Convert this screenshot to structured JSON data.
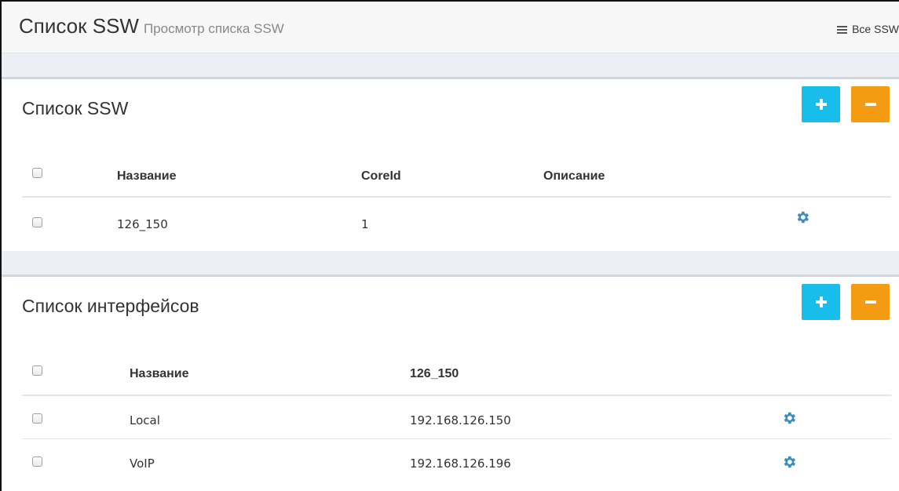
{
  "header": {
    "title": "Список SSW",
    "subtitle": "Просмотр списка SSW",
    "link_label": "Все SSW"
  },
  "ssw_section": {
    "title": "Список SSW",
    "columns": [
      "Название",
      "CoreId",
      "Описание"
    ],
    "rows": [
      {
        "name": "126_150",
        "core_id": "1",
        "description": ""
      }
    ]
  },
  "interfaces_section": {
    "title": "Список интерфейсов",
    "columns": [
      "Название",
      "126_150"
    ],
    "rows": [
      {
        "name": "Local",
        "address": "192.168.126.150"
      },
      {
        "name": "VoIP",
        "address": "192.168.126.196"
      }
    ]
  },
  "colors": {
    "add_button": "#18bdeb",
    "remove_button": "#f39c12",
    "gear_icon": "#3c8dbc"
  },
  "icons": {
    "add": "plus-icon",
    "remove": "minus-icon",
    "row_action": "gear-icon",
    "list": "list-icon"
  }
}
